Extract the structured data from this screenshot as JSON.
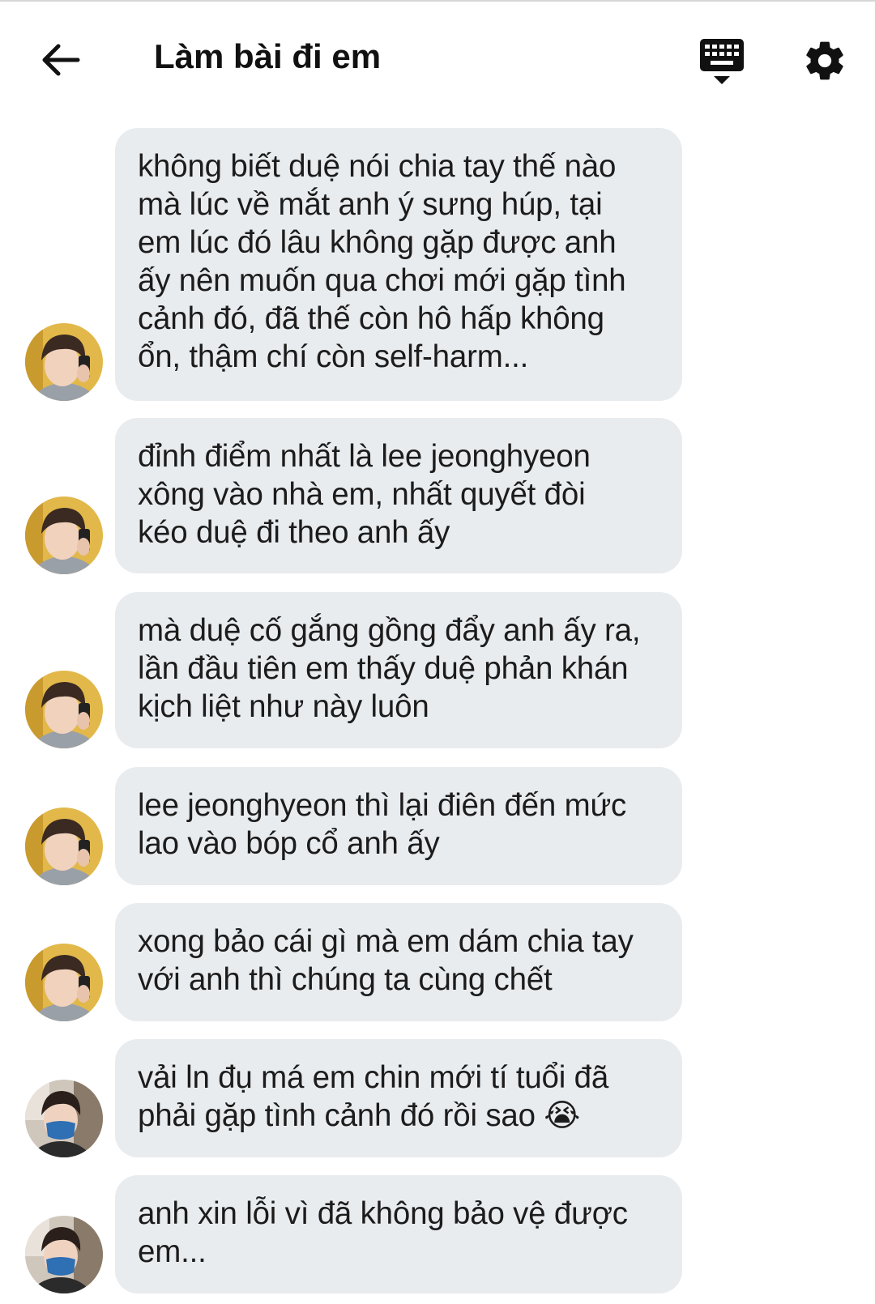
{
  "header": {
    "title": "Làm bài đi em",
    "back_icon": "arrow-left-icon",
    "keyboard_icon": "keyboard-icon",
    "settings_icon": "gear-icon"
  },
  "colors": {
    "bubble_bg": "#e9ecef",
    "text": "#1c1c1c",
    "icon": "#111111"
  },
  "messages": [
    {
      "avatar": "avatar-a",
      "text": "không biết duệ nói chia tay thế nào\nmà lúc về mắt anh ý sưng húp, tại\nem lúc đó lâu không gặp được anh\nấy nên muốn qua chơi mới gặp tình\ncảnh đó, đã thế còn hô hấp không\nổn, thậm chí còn self-harm..."
    },
    {
      "avatar": "avatar-a",
      "text": "đỉnh điểm nhất là lee jeonghyeon\nxông vào nhà em, nhất quyết đòi\nkéo duệ đi theo anh ấy"
    },
    {
      "avatar": "avatar-a",
      "text": "mà duệ cố gắng gồng đẩy anh ấy ra,\nlần đầu tiên em thấy duệ phản khán\nkịch liệt như này luôn"
    },
    {
      "avatar": "avatar-a",
      "text": " lee jeonghyeon thì lại điên đến mức\nlao vào bóp cổ anh ấy"
    },
    {
      "avatar": "avatar-a",
      "text": "xong bảo cái gì mà em dám chia tay\nvới anh thì chúng ta cùng chết"
    },
    {
      "avatar": "avatar-b",
      "text": "vải ln đụ má em chin mới tí tuổi đã\nphải gặp tình cảnh đó rồi sao 😭"
    },
    {
      "avatar": "avatar-b",
      "text": "anh xin lỗi vì đã không bảo vệ được\nem..."
    }
  ]
}
